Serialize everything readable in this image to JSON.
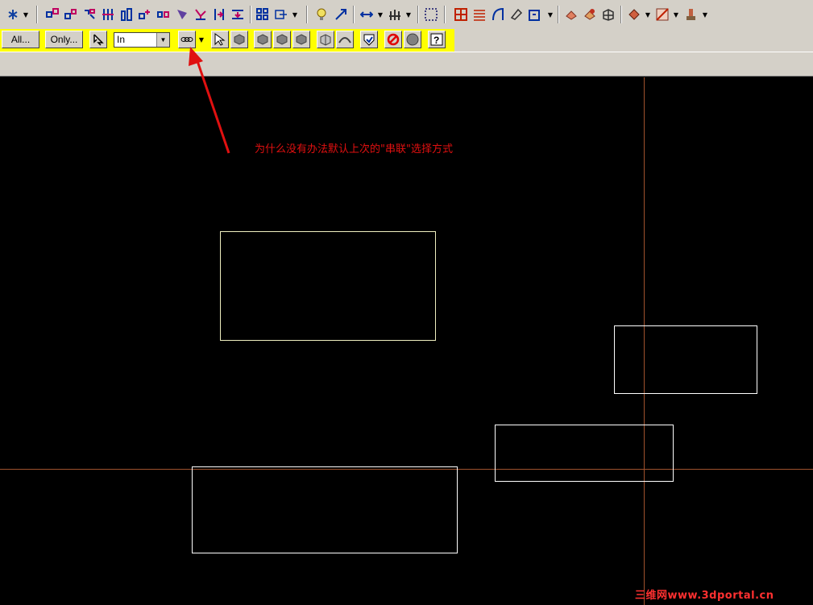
{
  "selection_bar": {
    "all_label": "All...",
    "only_label": "Only...",
    "mode_value": "In"
  },
  "annotation": {
    "text": "为什么没有办法默认上次的\"串联\"选择方式",
    "color": "#e01010"
  },
  "watermark": {
    "text": "三维网www.3dportal.cn"
  },
  "colors": {
    "toolbar_bg": "#d4d0c8",
    "selection_bar_bg": "#ffff00",
    "canvas_bg": "#000000",
    "geometry": "#ffffff",
    "axis": "#a0522d",
    "arrow": "#e01010"
  },
  "icons": {
    "toolbar_row1": [
      "snap-icon",
      "analyze-icon",
      "transform-icon",
      "mirror-icon",
      "align-icon",
      "array-icon",
      "translate-icon",
      "offset-icon",
      "rotate-icon",
      "trim-icon",
      "break-icon",
      "extend-icon",
      "layout-icon",
      "view-icon",
      "light-icon",
      "dimension-icon",
      "stretch-icon",
      "grid-icon",
      "pattern-icon",
      "table-icon",
      "surface-icon",
      "wireframe-icon",
      "solid-icon",
      "toolpath-icon",
      "settings-icon",
      "paint-icon",
      "screen-icon"
    ],
    "selection_bar": [
      "pointer-icon",
      "chain-icon",
      "select-arrow-icon",
      "solid-select-icon",
      "face-select-icon",
      "body-select-icon",
      "edge-select-icon",
      "box-select-icon",
      "surface-select-icon",
      "verify-icon",
      "cancel-icon",
      "circle-icon",
      "help-icon"
    ]
  }
}
